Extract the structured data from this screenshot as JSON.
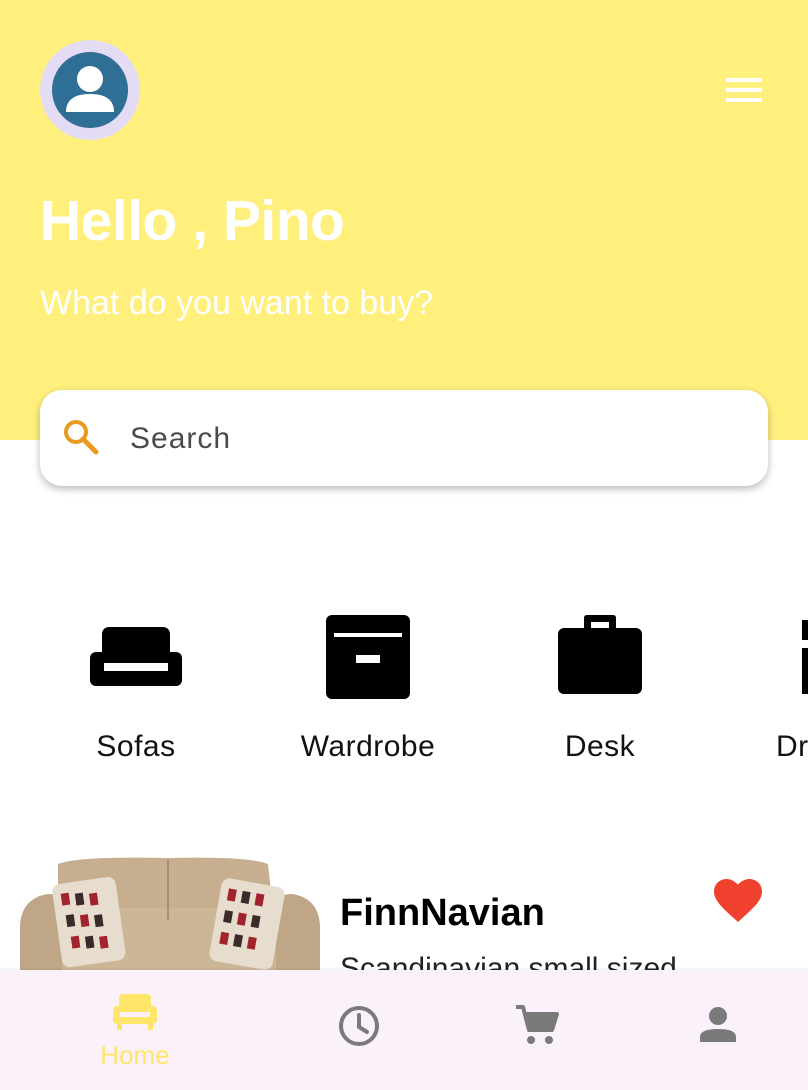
{
  "header": {
    "greeting": "Hello , Pino",
    "subtitle": "What do you want to buy?",
    "background_color": "#FFF07E",
    "avatar_icon": "person-icon",
    "menu_icon": "hamburger-menu-icon"
  },
  "search": {
    "placeholder": "Search",
    "icon": "search-icon",
    "icon_color": "#E99A1F"
  },
  "categories": [
    {
      "label": "Sofas",
      "icon": "sofa-icon"
    },
    {
      "label": "Wardrobe",
      "icon": "archive-box-icon"
    },
    {
      "label": "Desk",
      "icon": "briefcase-icon"
    },
    {
      "label": "Dr",
      "icon": "dresser-icon"
    }
  ],
  "product": {
    "title": "FinnNavian",
    "description": "Scandinavian small sized",
    "favorite": true,
    "favorite_color": "#F0412E"
  },
  "bottom_nav": {
    "items": [
      {
        "label": "Home",
        "icon": "sofa-icon",
        "active": true
      },
      {
        "label": "",
        "icon": "clock-icon",
        "active": false
      },
      {
        "label": "",
        "icon": "cart-icon",
        "active": false
      },
      {
        "label": "",
        "icon": "person-icon",
        "active": false
      }
    ],
    "active_color": "#FFE66A",
    "inactive_color": "#7A7A7A"
  }
}
